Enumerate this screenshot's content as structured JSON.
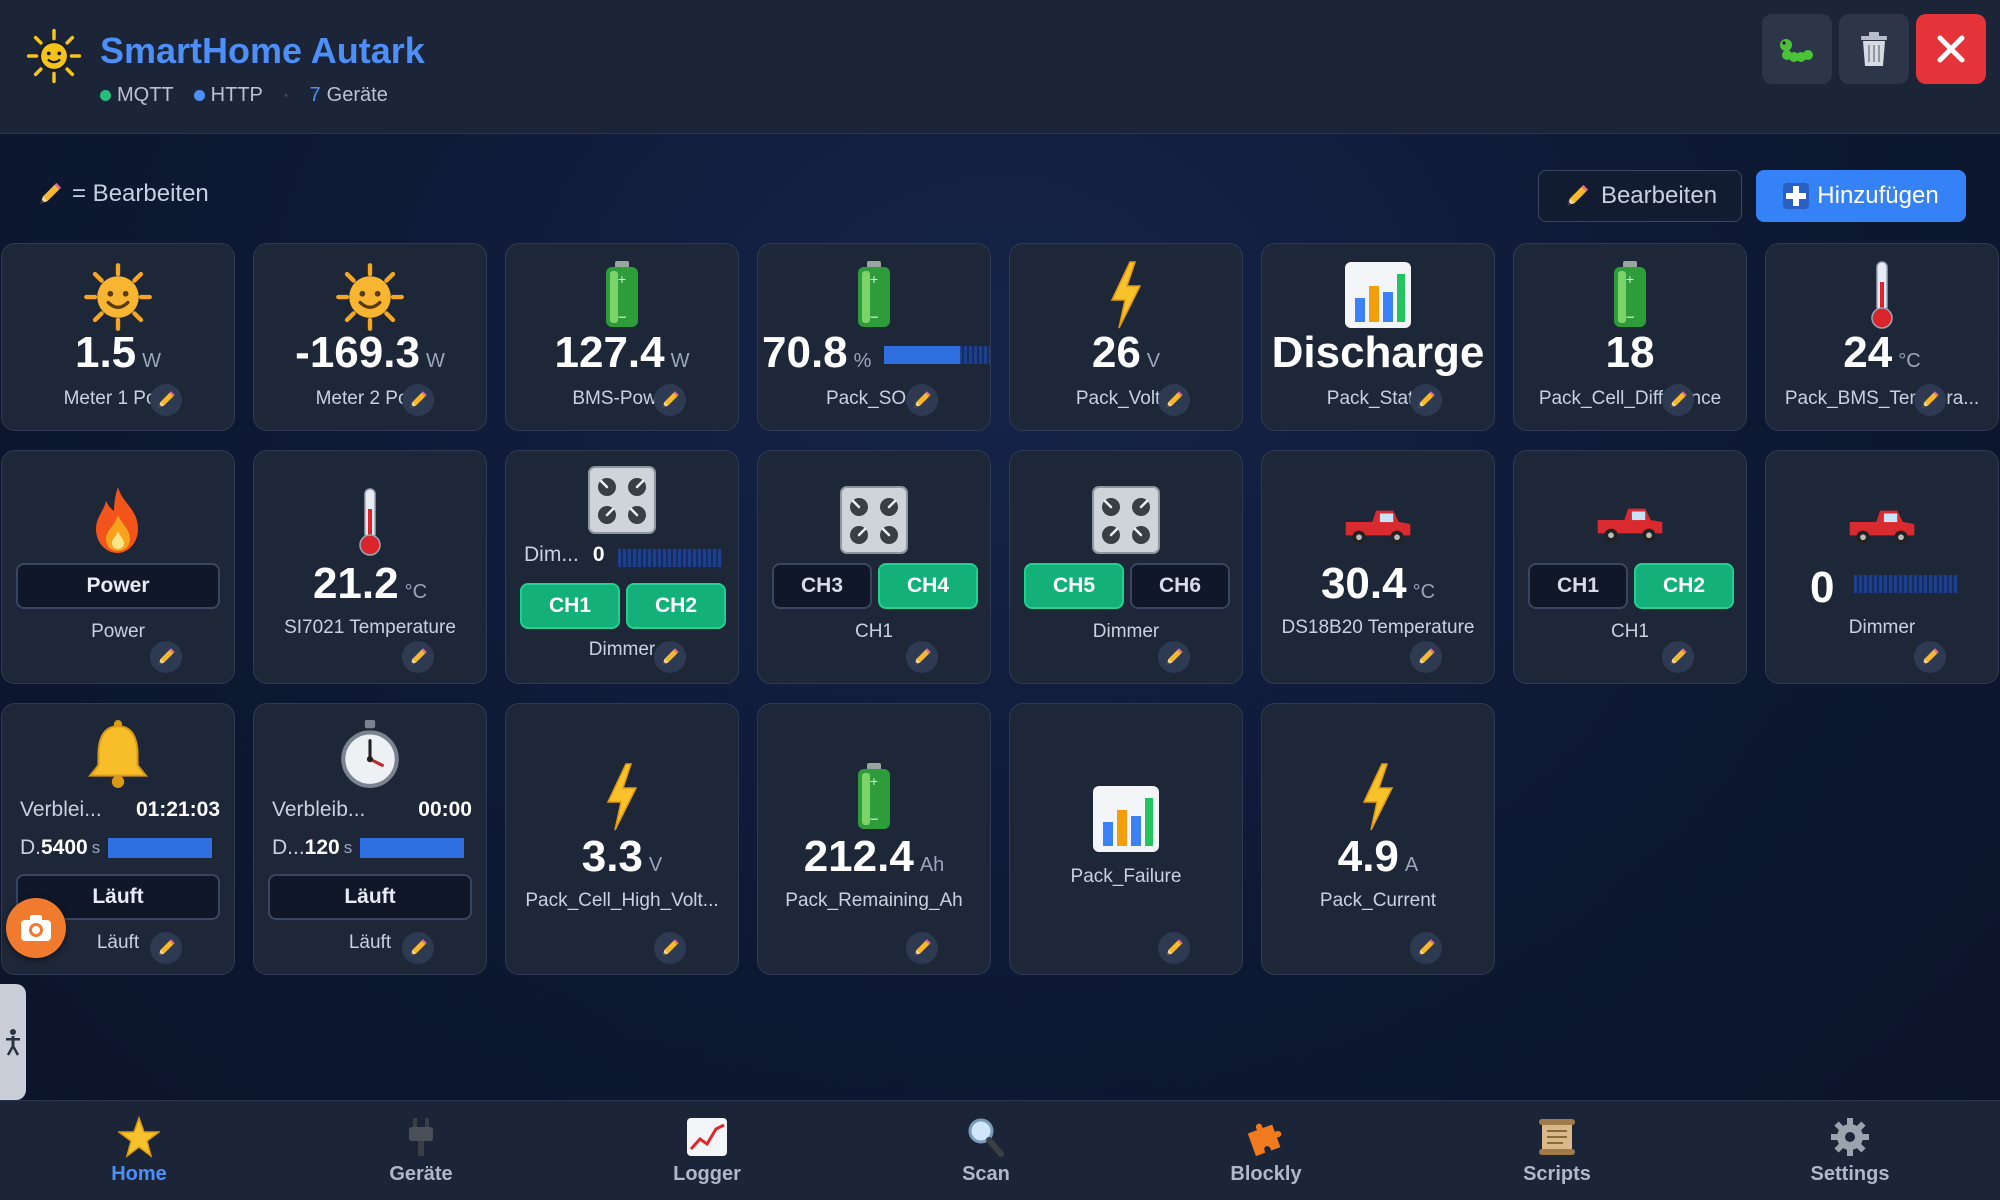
{
  "header": {
    "title": "SmartHome Autark",
    "status": [
      {
        "label": "MQTT",
        "color": "#22c07a"
      },
      {
        "label": "HTTP",
        "color": "#4d8ff7"
      }
    ],
    "device_count": "7",
    "device_count_label": "Geräte",
    "buttons": {
      "bug": "bug-icon",
      "trash": "trash-icon",
      "close": "close-icon"
    }
  },
  "toolbar": {
    "hint_text": "= Bearbeiten",
    "edit_label": "Bearbeiten",
    "add_label": "Hinzufügen"
  },
  "row1": [
    {
      "icon": "sun-icon",
      "value": "1.5",
      "unit": "W",
      "label": "Meter 1 Po..."
    },
    {
      "icon": "sun-icon",
      "value": "-169.3",
      "unit": "W",
      "label": "Meter 2 Po..."
    },
    {
      "icon": "battery-icon",
      "value": "127.4",
      "unit": "W",
      "label": "BMS-Pow..."
    },
    {
      "icon": "battery-icon",
      "value": "70.8",
      "unit": "%",
      "label": "Pack_SO...",
      "bar_percent": 70.8
    },
    {
      "icon": "lightning-icon",
      "value": "26",
      "unit": "V",
      "label": "Pack_Volt..."
    },
    {
      "icon": "chart-icon",
      "value": "Discharge",
      "unit": "",
      "label": "Pack_Stat..."
    },
    {
      "icon": "battery-icon",
      "value": "18",
      "unit": "",
      "label": "Pack_Cell_Difference"
    },
    {
      "icon": "thermometer-icon",
      "value": "24",
      "unit": "°C",
      "label": "Pack_BMS_Tempera..."
    }
  ],
  "row2": {
    "power": {
      "icon": "fire-icon",
      "button": "Power",
      "label": "Power"
    },
    "si7021": {
      "icon": "thermometer-icon",
      "value": "21.2",
      "unit": "°C",
      "label": "SI7021 Temperature"
    },
    "dimmer1": {
      "icon": "stove-icon",
      "dim_label": "Dim...",
      "dim_value": "0",
      "ch_a": "CH1",
      "ch_b": "CH2",
      "label": "Dimmer"
    },
    "ch34": {
      "icon": "stove-icon",
      "ch_a": "CH3",
      "ch_b": "CH4",
      "label": "CH1"
    },
    "ch56": {
      "icon": "stove-icon",
      "ch_a": "CH5",
      "ch_b": "CH6",
      "label": "Dimmer"
    },
    "ds18b20": {
      "icon": "truck-icon",
      "value": "30.4",
      "unit": "°C",
      "label": "DS18B20 Temperature"
    },
    "truck_ch": {
      "icon": "truck-icon",
      "ch_a": "CH1",
      "ch_b": "CH2",
      "label": "CH1"
    },
    "truck_dim": {
      "icon": "truck-icon",
      "value": "0",
      "label": "Dimmer"
    }
  },
  "row3": {
    "timer1": {
      "icon": "bell-icon",
      "remain_label": "Verblei...",
      "remain_value": "01:21:03",
      "dur_label": "D.",
      "dur_value": "5400",
      "dur_unit": "s",
      "button": "Läuft",
      "label": "Läuft"
    },
    "timer2": {
      "icon": "stopwatch-icon",
      "remain_label": "Verbleib...",
      "remain_value": "00:00",
      "dur_label": "D...",
      "dur_value": "120",
      "dur_unit": "s",
      "button": "Läuft",
      "label": "Läuft"
    },
    "cell_high": {
      "icon": "lightning-icon",
      "value": "3.3",
      "unit": "V",
      "label": "Pack_Cell_High_Volt..."
    },
    "remaining": {
      "icon": "battery-icon",
      "value": "212.4",
      "unit": "Ah",
      "label": "Pack_Remaining_Ah"
    },
    "failure": {
      "icon": "chart-icon",
      "label": "Pack_Failure"
    },
    "current": {
      "icon": "lightning-icon",
      "value": "4.9",
      "unit": "A",
      "label": "Pack_Current"
    }
  },
  "nav": [
    {
      "label": "Home",
      "icon": "star-icon",
      "active": true
    },
    {
      "label": "Geräte",
      "icon": "plug-icon"
    },
    {
      "label": "Logger",
      "icon": "chart-line-icon"
    },
    {
      "label": "Scan",
      "icon": "magnifier-icon"
    },
    {
      "label": "Blockly",
      "icon": "puzzle-icon"
    },
    {
      "label": "Scripts",
      "icon": "scroll-icon"
    },
    {
      "label": "Settings",
      "icon": "gear-icon"
    }
  ],
  "colors": {
    "accent": "#4d8ff7",
    "active_green": "#14b07a",
    "close_red": "#e5333a",
    "fab_orange": "#f07a2e"
  }
}
